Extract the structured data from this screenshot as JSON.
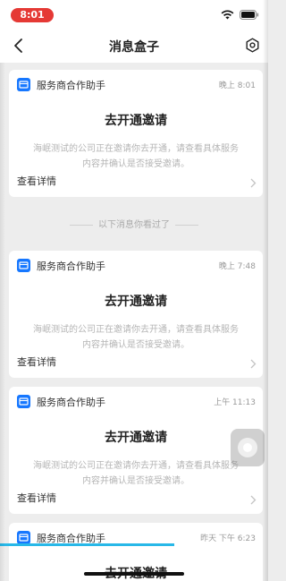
{
  "status_bar": {
    "time": "8:01"
  },
  "nav": {
    "title": "消息盒子"
  },
  "messages": [
    {
      "app_name": "服务商合作助手",
      "time": "晚上 8:01",
      "title": "去开通邀请",
      "body": "海岷测试的公司正在邀请你去开通，请查看具体服务内容并确认是否接受邀请。",
      "action_label": "查看详情"
    },
    {
      "app_name": "服务商合作助手",
      "time": "晚上 7:48",
      "title": "去开通邀请",
      "body": "海岷测试的公司正在邀请你去开通，请查看具体服务内容并确认是否接受邀请。",
      "action_label": "查看详情"
    },
    {
      "app_name": "服务商合作助手",
      "time": "上午 11:13",
      "title": "去开通邀请",
      "body": "海岷测试的公司正在邀请你去开通，请查看具体服务内容并确认是否接受邀请。",
      "action_label": "查看详情"
    },
    {
      "app_name": "服务商合作助手",
      "time": "昨天 下午 6:23",
      "title": "去开通邀请"
    }
  ],
  "divider": {
    "label": "以下消息你看过了"
  },
  "progress": {
    "fraction": 0.65
  },
  "colors": {
    "accent": "#1677ff",
    "time_pill": "#e53935",
    "progress": "#28b8e8"
  },
  "icons": [
    "back-icon",
    "settings-icon",
    "wifi-icon",
    "battery-icon",
    "app-icon",
    "chevron-right-icon"
  ]
}
